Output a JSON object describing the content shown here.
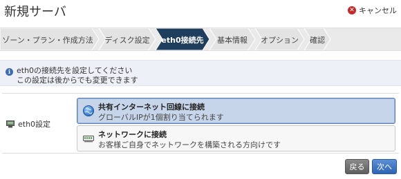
{
  "header": {
    "title": "新規サーバ",
    "cancel_label": "キャンセル"
  },
  "steps": [
    {
      "label": "ゾーン・プラン・作成方法",
      "state": "done"
    },
    {
      "label": "ディスク設定",
      "state": "done"
    },
    {
      "label": "eth0接続先",
      "state": "active"
    },
    {
      "label": "基本情報",
      "state": "pending"
    },
    {
      "label": "オプション",
      "state": "pending"
    },
    {
      "label": "確認",
      "state": "pending"
    }
  ],
  "info": {
    "icon": "info-icon",
    "line1": "eth0の接続先を設定してください",
    "line2": "この設定は後からでも変更できます"
  },
  "form": {
    "field_label": "eth0設定",
    "field_icon": "network-card-icon",
    "options": [
      {
        "title": "共有インターネット回線に接続",
        "desc": "グローバルIPが1個割り当てられます",
        "icon": "globe-icon",
        "selected": true
      },
      {
        "title": "ネットワークに接続",
        "desc": "お客様ご自身でネットワークを構築される方向けです",
        "icon": "switch-icon",
        "selected": false
      }
    ]
  },
  "footer": {
    "back_label": "戻る",
    "next_label": "次へ"
  },
  "colors": {
    "active_step": "#1f3d5c",
    "step_bg": "#eaeaea",
    "next_button": "#3a6fc2",
    "back_button": "#6e6e6e",
    "selected_option": "#c6d5ea"
  }
}
